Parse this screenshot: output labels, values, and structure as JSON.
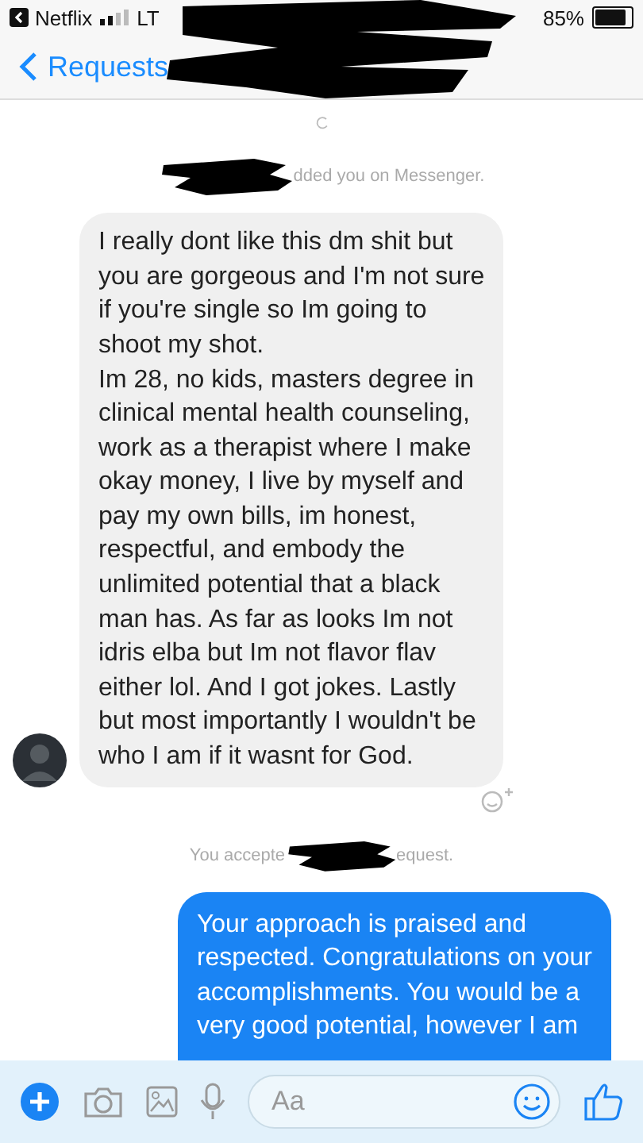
{
  "status_bar": {
    "back_app": "Netflix",
    "network": "LT",
    "battery": "85%"
  },
  "nav": {
    "back_label": "Requests"
  },
  "messages": [
    {
      "kind": "system",
      "after": "dded you on Messenger."
    },
    {
      "kind": "incoming",
      "text": "I really dont like this dm shit but\nyou are gorgeous and I'm not sure\nif you're single so Im going to\nshoot my shot.\nIm 28, no kids, masters degree in\nclinical mental health counseling,\nwork as a therapist where I make\nokay money, I live by myself and\npay my own bills, im honest,\nrespectful, and embody the\nunlimited potential that a black\nman has. As far as looks Im not\nidris elba but Im not flavor flav\neither lol. And I got jokes. Lastly\nbut most importantly I wouldn't be\nwho I am if it wasnt for God."
    },
    {
      "kind": "system",
      "before": "You accepte",
      "after": "equest."
    },
    {
      "kind": "outgoing",
      "text": "Your approach is praised and\nrespected. Congratulations on your\naccomplishments. You would be a\nvery good potential, however I am"
    }
  ],
  "composer": {
    "placeholder": "Aa"
  }
}
